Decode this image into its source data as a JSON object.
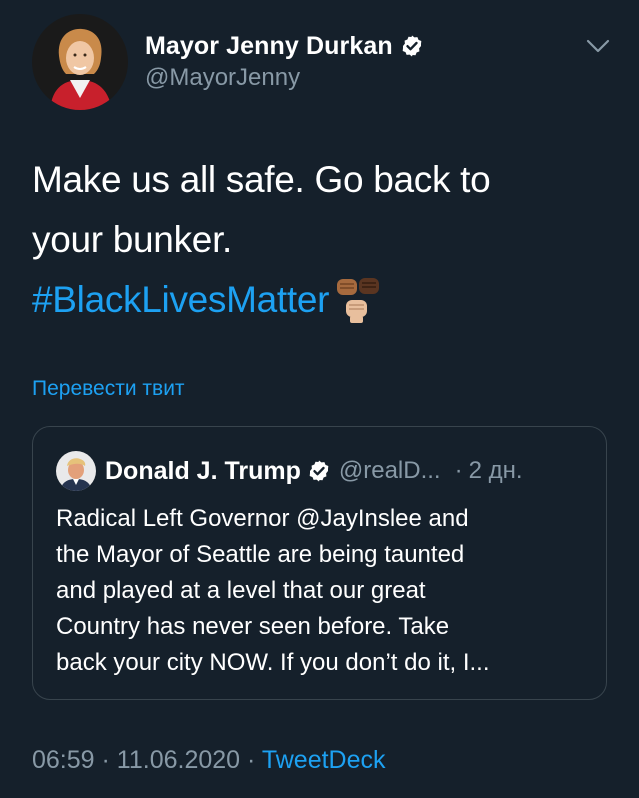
{
  "author": {
    "display_name": "Mayor Jenny Durkan",
    "handle": "@MayorJenny",
    "verified": true,
    "avatar_icon": "profile-photo"
  },
  "tweet": {
    "line1": "Make us all safe. Go back to",
    "line2": "your bunker.",
    "hashtag": "#BlackLivesMatter",
    "emoji": "raised-fists-emoji"
  },
  "translate_link": "Перевести твит",
  "quoted_tweet": {
    "display_name": "Donald J. Trump",
    "handle": "@realD...",
    "separator": "·",
    "time": "2 дн.",
    "verified": true,
    "lines": [
      "Radical Left Governor @JayInslee and",
      "the Mayor of Seattle are being taunted",
      "and played at a level that our great",
      "Country has never seen before. Take",
      "back your city NOW. If you don’t do it, I..."
    ]
  },
  "footer": {
    "time": "06:59",
    "sep1": "·",
    "date": "11.06.2020",
    "sep2": "·",
    "app": "TweetDeck"
  },
  "colors": {
    "background": "#15202b",
    "link": "#1da1f2",
    "secondary_text": "#8899a6",
    "border": "#38444d"
  }
}
